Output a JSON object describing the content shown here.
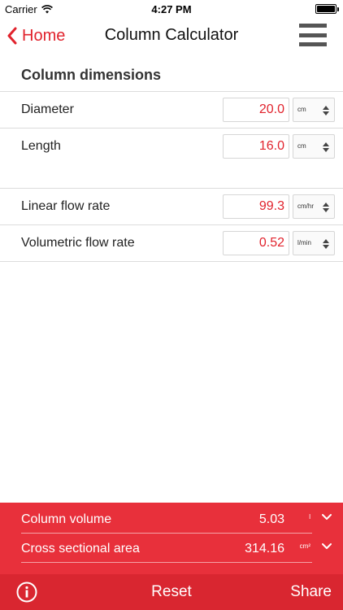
{
  "status_bar": {
    "carrier": "Carrier",
    "time": "4:27 PM"
  },
  "nav": {
    "back_label": "Home",
    "title": "Column Calculator"
  },
  "section": {
    "title": "Column dimensions"
  },
  "dimensions": [
    {
      "label": "Diameter",
      "value": "20.0",
      "unit": "cm"
    },
    {
      "label": "Length",
      "value": "16.0",
      "unit": "cm"
    }
  ],
  "flow": [
    {
      "label": "Linear flow rate",
      "value": "99.3",
      "unit": "cm/hr"
    },
    {
      "label": "Volumetric flow rate",
      "value": "0.52",
      "unit": "l/min"
    }
  ],
  "results": [
    {
      "label": "Column volume",
      "value": "5.03",
      "unit": "l"
    },
    {
      "label": "Cross sectional area",
      "value": "314.16",
      "unit": "cm²"
    }
  ],
  "toolbar": {
    "reset_label": "Reset",
    "share_label": "Share"
  },
  "colors": {
    "accent": "#e1232d",
    "panel": "#e8303b",
    "toolbar": "#d92630"
  }
}
